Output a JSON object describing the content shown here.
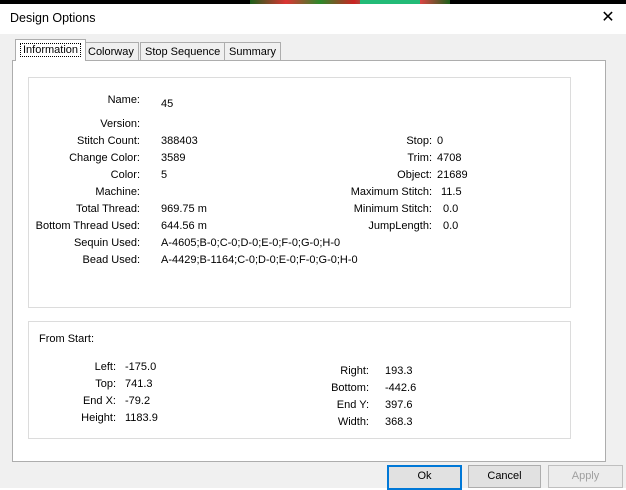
{
  "window": {
    "title": "Design Options",
    "close_glyph": "✕"
  },
  "tabs": [
    {
      "label": "Information",
      "active": true
    },
    {
      "label": "Colorway",
      "active": false
    },
    {
      "label": "Stop Sequence",
      "active": false
    },
    {
      "label": "Summary",
      "active": false
    }
  ],
  "info": {
    "name_label": "Name:",
    "name": "45",
    "version_label": "Version:",
    "version": "",
    "stitch_count_label": "Stitch Count:",
    "stitch_count": "388403",
    "change_color_label": "Change Color:",
    "change_color": "3589",
    "color_label": "Color:",
    "color": "5",
    "machine_label": "Machine:",
    "machine": "",
    "total_thread_label": "Total Thread:",
    "total_thread": "969.75 m",
    "bottom_thread_label": "Bottom Thread Used:",
    "bottom_thread": "644.56 m",
    "sequin_label": "Sequin Used:",
    "sequin": "A-4605;B-0;C-0;D-0;E-0;F-0;G-0;H-0",
    "bead_label": "Bead Used:",
    "bead": "A-4429;B-1164;C-0;D-0;E-0;F-0;G-0;H-0",
    "stop_label": "Stop:",
    "stop": "0",
    "trim_label": "Trim:",
    "trim": "4708",
    "object_label": "Object:",
    "object": "21689",
    "max_stitch_label": "Maximum Stitch:",
    "max_stitch": "11.5",
    "min_stitch_label": "Minimum Stitch:",
    "min_stitch": "0.0",
    "jump_label": "JumpLength:",
    "jump": "0.0"
  },
  "from_start": {
    "heading": "From Start:",
    "left_label": "Left:",
    "left": "-175.0",
    "top_label": "Top:",
    "top": "741.3",
    "endx_label": "End X:",
    "endx": "-79.2",
    "height_label": "Height:",
    "height": "1183.9",
    "right_label": "Right:",
    "right": "193.3",
    "bottom_label": "Bottom:",
    "bottom": "-442.6",
    "endy_label": "End Y:",
    "endy": "397.6",
    "width_label": "Width:",
    "width": "368.3"
  },
  "buttons": {
    "ok": "Ok",
    "cancel": "Cancel",
    "apply": "Apply"
  }
}
